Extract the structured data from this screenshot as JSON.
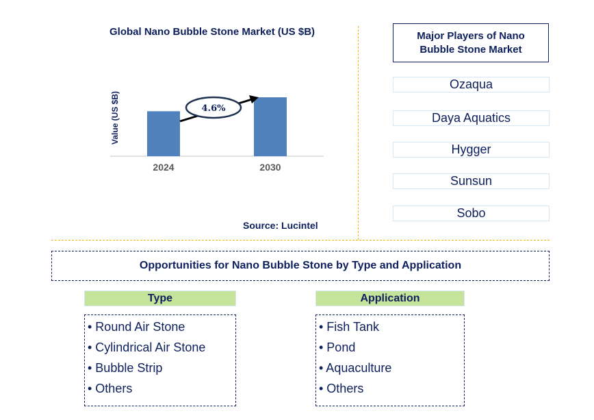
{
  "chart_data": {
    "type": "bar",
    "title": "Global Nano Bubble Stone Market (US $B)",
    "xlabel": "",
    "ylabel": "Value (US $B)",
    "categories": [
      "2024",
      "2030"
    ],
    "values": [
      1.0,
      1.31
    ],
    "value_note": "relative values estimated from bar heights; no y-axis ticks shown",
    "annotation": {
      "label": "4.6%",
      "meaning": "CAGR from 2024 to 2030",
      "type": "arrow-with-ellipse"
    },
    "grid": false,
    "legend": "none",
    "bar_color": "#4f81bd"
  },
  "source": "Source: Lucintel",
  "players": {
    "title": "Major Players of Nano Bubble Stone Market",
    "items": [
      "Ozaqua",
      "Daya Aquatics",
      "Hygger",
      "Sunsun",
      "Sobo"
    ]
  },
  "opportunities": {
    "title": "Opportunities for Nano Bubble Stone by Type and Application",
    "type": {
      "heading": "Type",
      "items": [
        "Round Air Stone",
        "Cylindrical Air Stone",
        "Bubble Strip",
        "Others"
      ]
    },
    "application": {
      "heading": "Application",
      "items": [
        "Fish Tank",
        "Pond",
        "Aquaculture",
        "Others"
      ]
    }
  },
  "colors": {
    "navy": "#0d1f5c",
    "bar": "#4f81bd",
    "header_green": "#c5e39b",
    "separator": "#f5b800",
    "player_border": "#d6e8f5"
  }
}
